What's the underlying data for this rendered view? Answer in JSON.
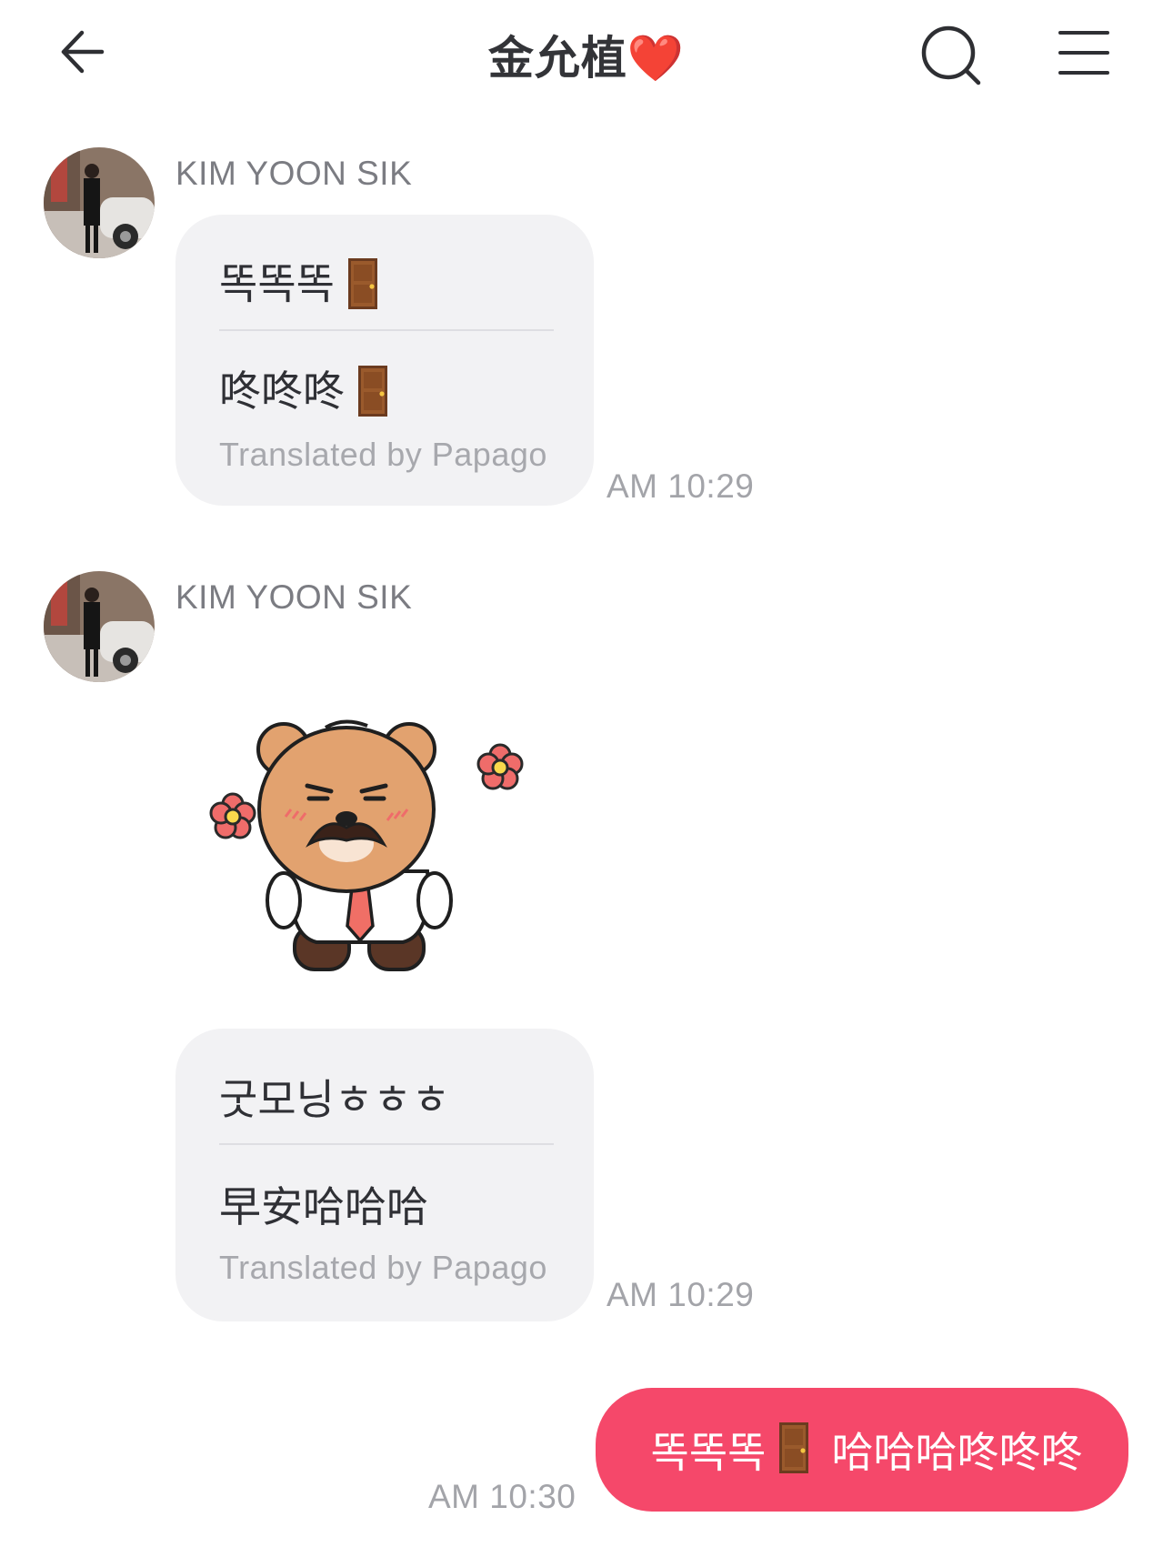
{
  "header": {
    "title": "金允植",
    "title_emoji": "❤️"
  },
  "messages": [
    {
      "sender": "KIM YOON SIK",
      "original": "똑똑똑",
      "original_emoji": "door",
      "translated": "咚咚咚",
      "translated_emoji": "door",
      "translated_by": "Translated by Papago",
      "time": "AM 10:29"
    },
    {
      "sender": "KIM YOON SIK",
      "sticker": "mustache-bear-sticker"
    },
    {
      "original": "굿모닝ㅎㅎㅎ",
      "translated": "早安哈哈哈",
      "translated_by": "Translated by Papago",
      "time": "AM 10:29"
    }
  ],
  "outgoing": {
    "text_before": "똑똑똑",
    "emoji": "door",
    "text_after": "哈哈哈咚咚咚",
    "time": "AM 10:30"
  },
  "colors": {
    "outgoing_bubble": "#f5486a",
    "incoming_bubble": "#f2f2f4",
    "heart": "#e8213b"
  }
}
